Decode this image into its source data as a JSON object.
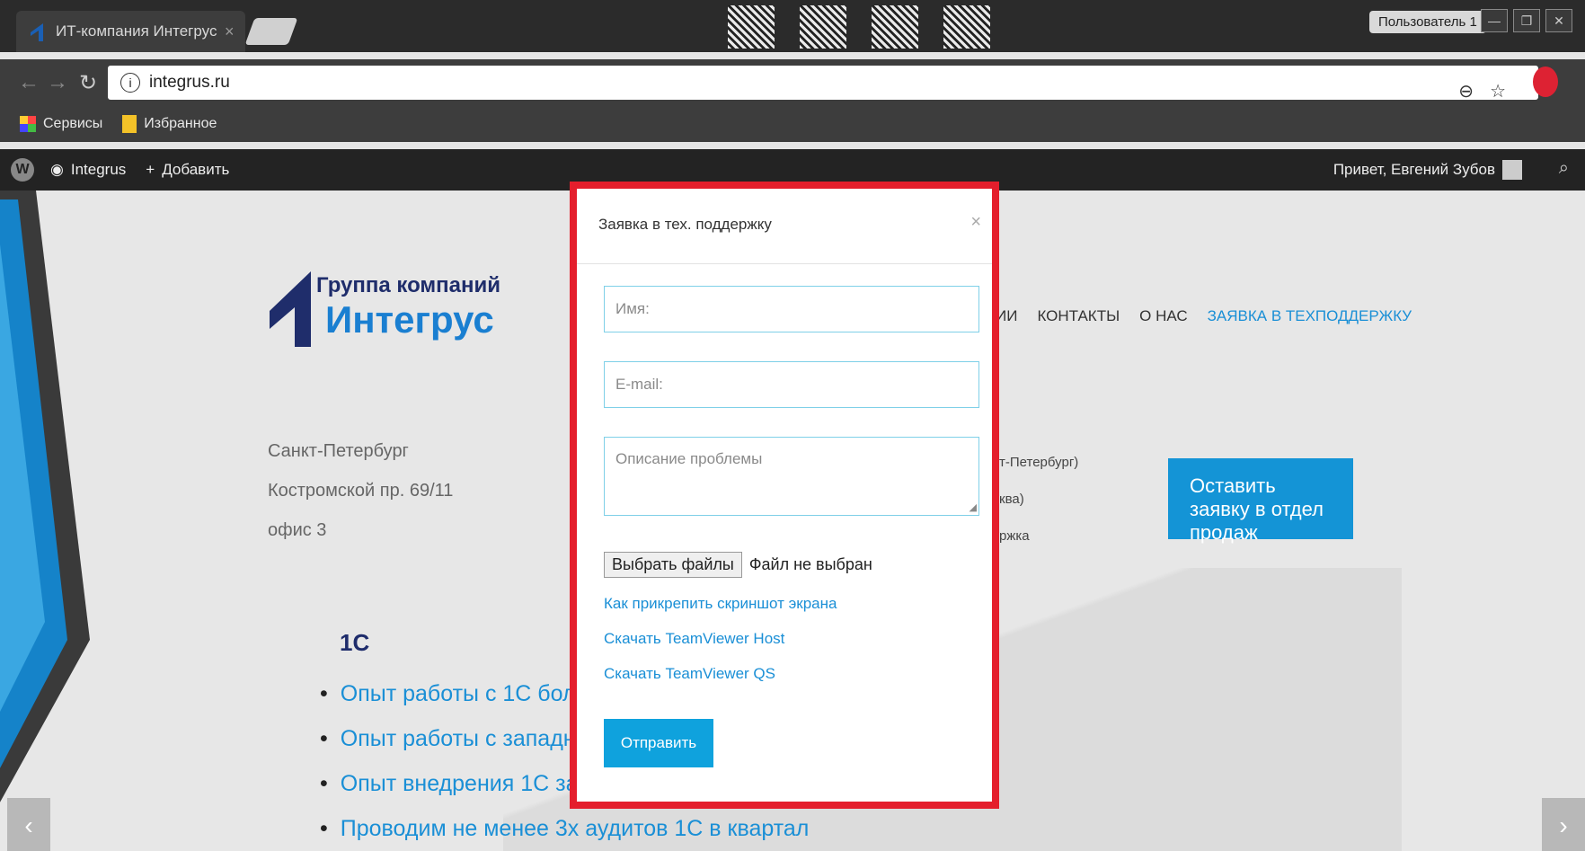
{
  "browser": {
    "tab_title": "ИТ-компания Интегрус",
    "tab_close": "×",
    "user_label": "Пользователь 1",
    "url": "integrus.ru",
    "bookmarks": [
      "Сервисы",
      "Избранное"
    ]
  },
  "wp_admin": {
    "site": "Integrus",
    "add": "Добавить",
    "greeting": "Привет, Евгений Зубов"
  },
  "site": {
    "logo_line1": "Группа компаний",
    "logo_line2": "Интегрус",
    "menu": [
      "ИИ",
      "КОНТАКТЫ",
      "О НАС",
      "ЗАЯВКА В ТЕХПОДДЕРЖКУ"
    ],
    "address": [
      "Санкт-Петербург",
      "Костромской пр. 69/11",
      "офис 3"
    ],
    "contacts_fragment": [
      "т-Петербург)",
      "ква)",
      "ржка"
    ],
    "sales_button": "Оставить заявку в отдел продаж",
    "section_title": "1С",
    "bullets": [
      "Опыт работы с 1С более",
      "Опыт работы с западным",
      "Опыт внедрения 1С за ру",
      "Проводим не менее 3х аудитов 1С в квартал"
    ],
    "arrow_prev": "‹",
    "arrow_next": "›"
  },
  "modal": {
    "title": "Заявка в тех. поддержку",
    "close": "×",
    "name_placeholder": "Имя:",
    "email_placeholder": "E-mail:",
    "desc_placeholder": "Описание проблемы",
    "file_button": "Выбрать файлы",
    "file_status": "Файл не выбран",
    "links": [
      "Как прикрепить скриншот экрана",
      "Скачать TeamViewer Host",
      "Скачать TeamViewer QS"
    ],
    "submit": "Отправить"
  },
  "colors": {
    "accent": "#1a8fd6",
    "highlight_border": "#e41e2c",
    "brand_dark": "#1f2d6b"
  }
}
